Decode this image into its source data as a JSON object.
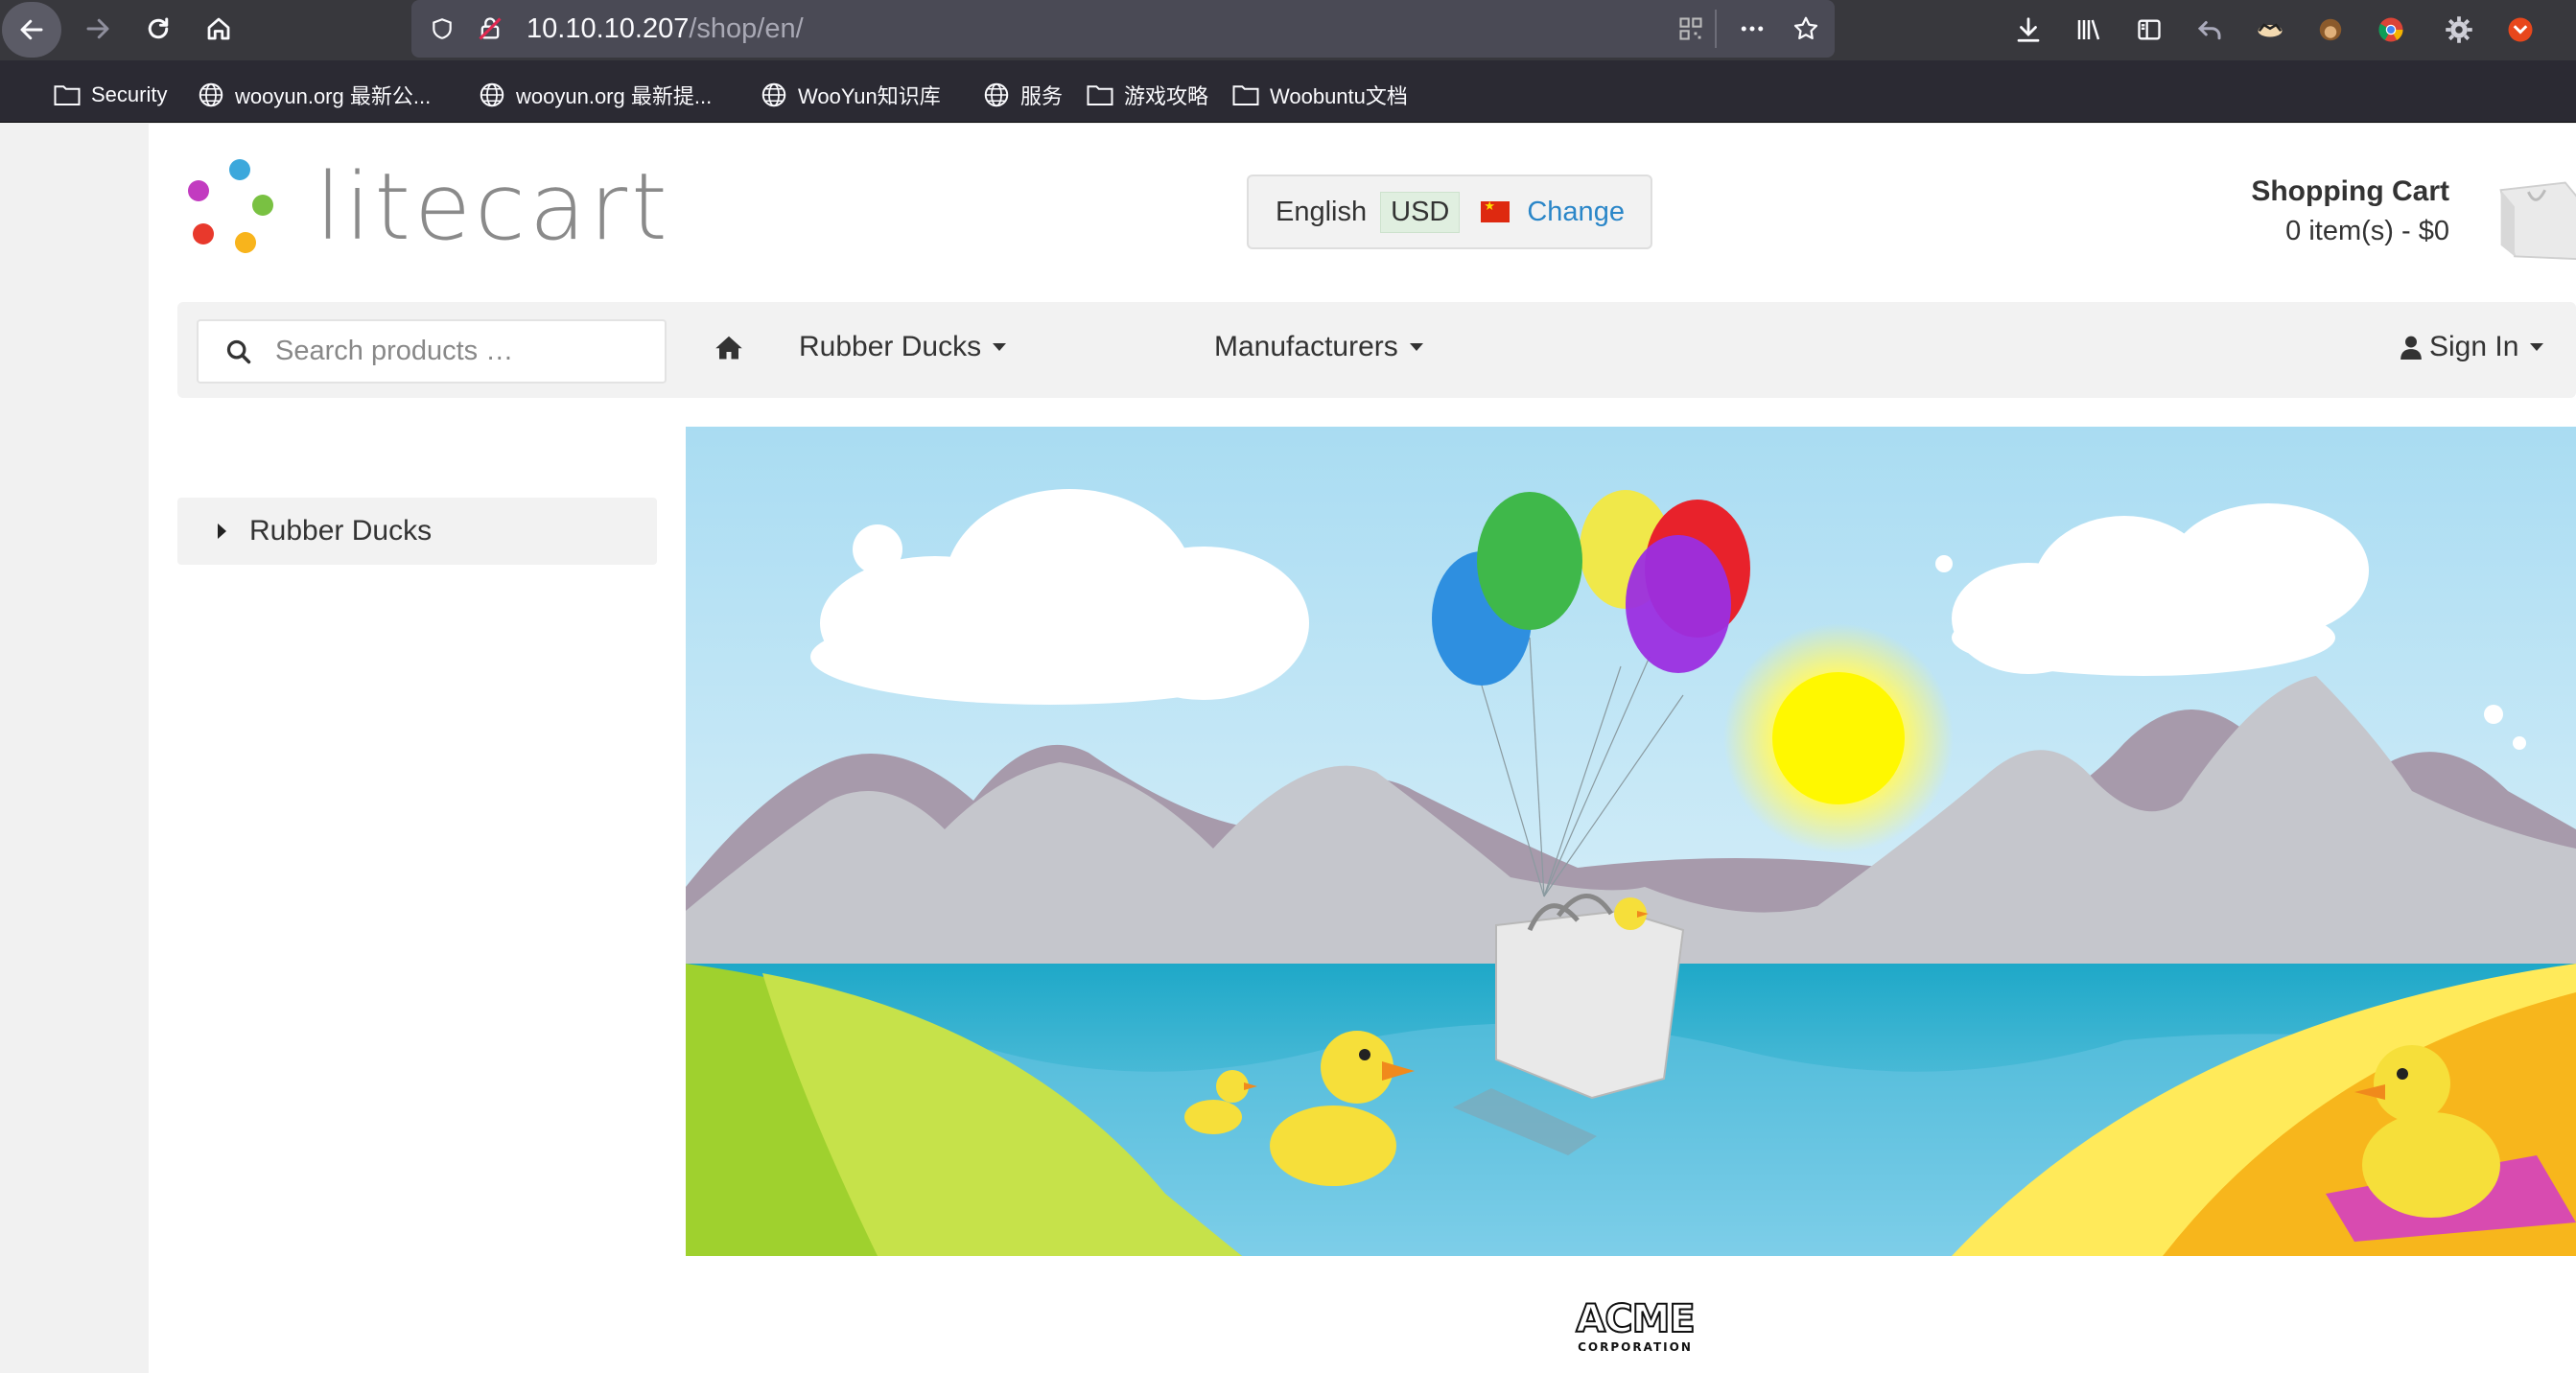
{
  "browser": {
    "url_host": "10.10.10.207",
    "url_path": "/shop/en/",
    "bookmarks": [
      {
        "label": "Security",
        "icon": "folder-icon"
      },
      {
        "label": "wooyun.org 最新公...",
        "icon": "globe-icon"
      },
      {
        "label": "wooyun.org 最新提...",
        "icon": "globe-icon"
      },
      {
        "label": "WooYun知识库",
        "icon": "globe-icon"
      },
      {
        "label": "服务",
        "icon": "globe-icon"
      },
      {
        "label": "游戏攻略",
        "icon": "folder-icon"
      },
      {
        "label": "Woobuntu文档",
        "icon": "folder-icon"
      }
    ]
  },
  "header": {
    "logo_text": "litecart",
    "language": "English",
    "currency": "USD",
    "change_label": "Change",
    "cart_title": "Shopping Cart",
    "cart_summary": "0 item(s) - $0"
  },
  "navbar": {
    "search_placeholder": "Search products …",
    "menu_rubber_ducks": "Rubber Ducks",
    "menu_manufacturers": "Manufacturers",
    "sign_in": "Sign In"
  },
  "sidebar": {
    "category": "Rubber Ducks"
  },
  "footer": {
    "manufacturer_logo_text": "ACME",
    "manufacturer_logo_subtext": "CORPORATION"
  },
  "colors": {
    "accent_link": "#2a86c8",
    "browser_toolbar": "#38383d",
    "bookmarks_bar": "#2b2a33"
  }
}
